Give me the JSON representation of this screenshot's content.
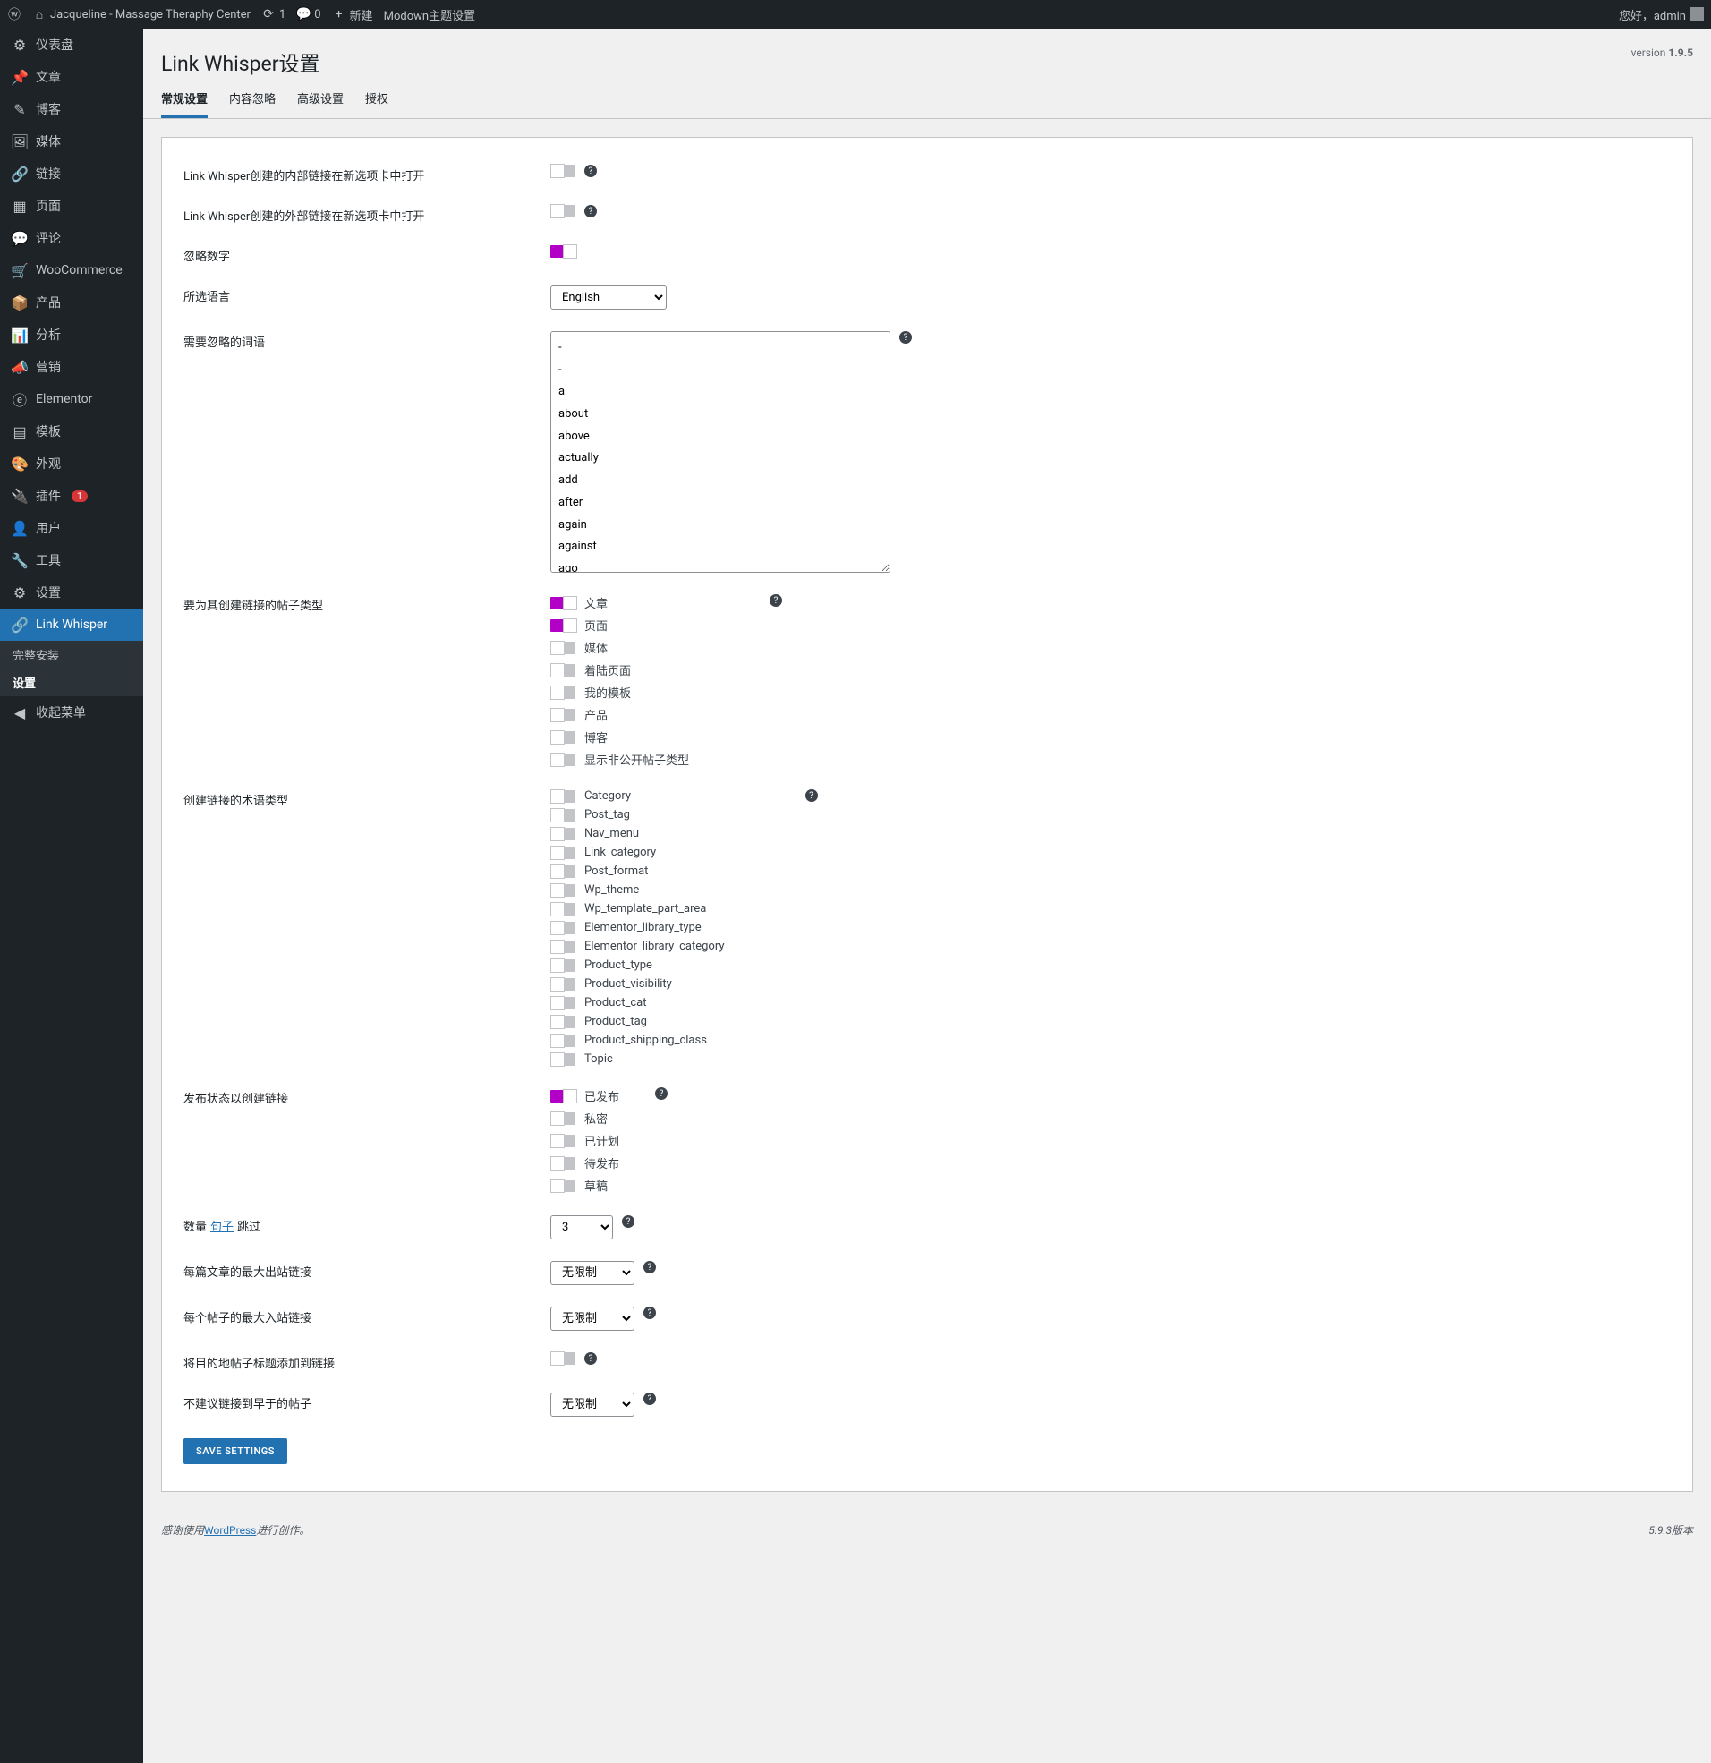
{
  "adminbar": {
    "site_name": "Jacqueline - Massage Theraphy Center",
    "updates": "1",
    "comments": "0",
    "new": "新建",
    "modown": "Modown主题设置",
    "greeting": "您好，admin"
  },
  "sidebar": {
    "items": [
      {
        "label": "仪表盘"
      },
      {
        "label": "文章"
      },
      {
        "label": "博客"
      },
      {
        "label": "媒体"
      },
      {
        "label": "链接"
      },
      {
        "label": "页面"
      },
      {
        "label": "评论"
      },
      {
        "label": "WooCommerce"
      },
      {
        "label": "产品"
      },
      {
        "label": "分析"
      },
      {
        "label": "营销"
      },
      {
        "label": "Elementor"
      },
      {
        "label": "模板"
      },
      {
        "label": "外观"
      },
      {
        "label": "插件",
        "badge": "1"
      },
      {
        "label": "用户"
      },
      {
        "label": "工具"
      },
      {
        "label": "设置"
      },
      {
        "label": "Link Whisper",
        "current": true
      },
      {
        "label": "收起菜单"
      }
    ],
    "submenu": [
      {
        "label": "完整安装"
      },
      {
        "label": "设置",
        "current": true
      }
    ]
  },
  "page": {
    "title": "Link Whisper设置",
    "version_prefix": "version ",
    "version": "1.9.5"
  },
  "tabs": [
    {
      "label": "常规设置",
      "active": true
    },
    {
      "label": "内容忽略"
    },
    {
      "label": "高级设置"
    },
    {
      "label": "授权"
    }
  ],
  "settings": {
    "internal_new_tab": "Link Whisper创建的内部链接在新选项卡中打开",
    "external_new_tab": "Link Whisper创建的外部链接在新选项卡中打开",
    "ignore_numbers": "忽略数字",
    "language": {
      "label": "所选语言",
      "value": "English"
    },
    "ignore_words": {
      "label": "需要忽略的词语",
      "value": "-\n-\na\nabout\nabove\nactually\nadd\nafter\nagain\nagainst\nago"
    },
    "post_types": {
      "label": "要为其创建链接的帖子类型",
      "items": [
        {
          "label": "文章",
          "on": true
        },
        {
          "label": "页面",
          "on": true
        },
        {
          "label": "媒体",
          "on": false
        },
        {
          "label": "着陆页面",
          "on": false
        },
        {
          "label": "我的模板",
          "on": false
        },
        {
          "label": "产品",
          "on": false
        },
        {
          "label": "博客",
          "on": false
        },
        {
          "label": "显示非公开帖子类型",
          "on": false
        }
      ]
    },
    "term_types": {
      "label": "创建链接的术语类型",
      "items": [
        {
          "label": "Category"
        },
        {
          "label": "Post_tag"
        },
        {
          "label": "Nav_menu"
        },
        {
          "label": "Link_category"
        },
        {
          "label": "Post_format"
        },
        {
          "label": "Wp_theme"
        },
        {
          "label": "Wp_template_part_area"
        },
        {
          "label": "Elementor_library_type"
        },
        {
          "label": "Elementor_library_category"
        },
        {
          "label": "Product_type"
        },
        {
          "label": "Product_visibility"
        },
        {
          "label": "Product_cat"
        },
        {
          "label": "Product_tag"
        },
        {
          "label": "Product_shipping_class"
        },
        {
          "label": "Topic"
        }
      ]
    },
    "publish_status": {
      "label": "发布状态以创建链接",
      "items": [
        {
          "label": "已发布",
          "on": true
        },
        {
          "label": "私密",
          "on": false
        },
        {
          "label": "已计划",
          "on": false
        },
        {
          "label": "待发布",
          "on": false
        },
        {
          "label": "草稿",
          "on": false
        }
      ]
    },
    "skip": {
      "pre": "数量",
      "link": "句子",
      "post": "跳过",
      "value": "3"
    },
    "max_outbound": {
      "label": "每篇文章的最大出站链接",
      "value": "无限制"
    },
    "max_inbound": {
      "label": "每个帖子的最大入站链接",
      "value": "无限制"
    },
    "add_title": "将目的地帖子标题添加到链接",
    "no_old": {
      "label": "不建议链接到早于的帖子",
      "value": "无限制"
    },
    "save": "SAVE SETTINGS"
  },
  "footer": {
    "thanks_pre": "感谢使用",
    "wp": "WordPress",
    "thanks_post": "进行创作。",
    "version": "5.9.3版本"
  }
}
